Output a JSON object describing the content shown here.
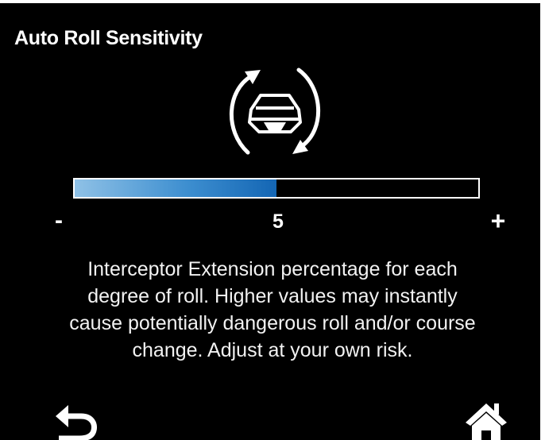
{
  "screen": {
    "title": "Auto Roll Sensitivity",
    "icon": "boat-roll-icon"
  },
  "slider": {
    "value": "5",
    "fill_fraction": 0.5,
    "minus_label": "-",
    "plus_label": "+",
    "fill_color": "#1466b4"
  },
  "description": {
    "lines": [
      "Interceptor Extension percentage for each",
      "degree of roll. Higher values may instantly",
      "cause potentially dangerous roll and/or course",
      "change. Adjust at your own risk."
    ]
  },
  "nav": {
    "back_icon": "back-arrow-icon",
    "home_icon": "home-icon"
  }
}
